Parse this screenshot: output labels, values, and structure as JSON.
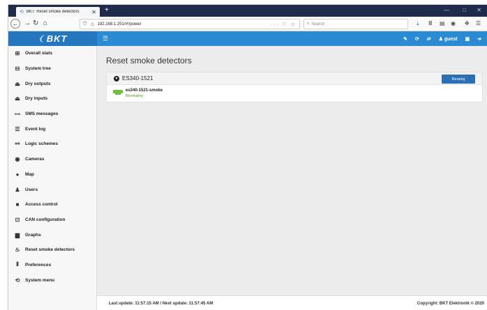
{
  "browser": {
    "tab_title": "BKT: Reset smoke detectors",
    "tab_close": "✕",
    "new_tab": "+",
    "url": "192.168.1.251/#!/power",
    "url_actions": "··· ♡ ☆",
    "search_placeholder": "Search",
    "window_controls": [
      "—",
      "□",
      "✕"
    ]
  },
  "app": {
    "logo": "BKT",
    "user": "guest"
  },
  "sidebar": {
    "items": [
      {
        "label": "Overall stats",
        "icon": "grid-icon"
      },
      {
        "label": "System tree",
        "icon": "tree-icon"
      },
      {
        "label": "Dry outputs",
        "icon": "output-icon"
      },
      {
        "label": "Dry inputs",
        "icon": "input-icon"
      },
      {
        "label": "SMS messages",
        "icon": "sms-icon"
      },
      {
        "label": "Event log",
        "icon": "list-icon"
      },
      {
        "label": "Logic schemes",
        "icon": "link-icon"
      },
      {
        "label": "Cameras",
        "icon": "eye-icon"
      },
      {
        "label": "Map",
        "icon": "map-pin-icon"
      },
      {
        "label": "Users",
        "icon": "users-icon"
      },
      {
        "label": "Access control",
        "icon": "lock-icon"
      },
      {
        "label": "CAN configuration",
        "icon": "can-icon"
      },
      {
        "label": "Graphs",
        "icon": "bar-chart-icon"
      },
      {
        "label": "Reset smoke detectors",
        "icon": "fire-icon"
      },
      {
        "label": "Preferences",
        "icon": "sliders-icon"
      },
      {
        "label": "System menu",
        "icon": "system-icon"
      }
    ]
  },
  "main": {
    "title": "Reset smoke detectors",
    "device": {
      "name": "ES340-1521",
      "reset_button": "Resetuj",
      "sensor_name": "es340-1521-smoke",
      "sensor_status": "Normalny"
    }
  },
  "footer": {
    "last_update": "Last update: 11:57:15 AM / Next update: 11:57:45 AM",
    "copyright": "Copyright: BKT Elektronik © 2020"
  },
  "colors": {
    "header_blue": "#2a8ad4",
    "logo_blue": "#2476be",
    "button_blue": "#2d6fb5",
    "status_green": "#7ab648"
  }
}
